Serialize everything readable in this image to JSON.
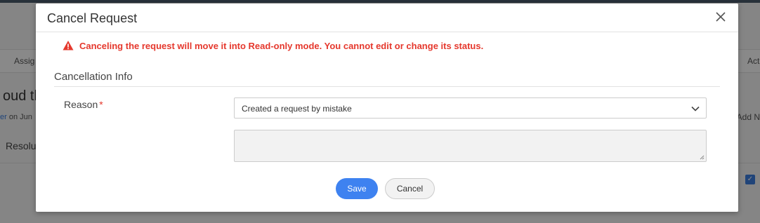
{
  "background": {
    "toolbar_left": "Assig",
    "toolbar_right": "Act",
    "title_fragment": "oud th",
    "meta_link": "er",
    "meta_text": "on Jun",
    "add_note": "Add N",
    "resolution_fragment": "Resolu"
  },
  "modal": {
    "title": "Cancel Request",
    "close_icon": "close-icon",
    "warning": {
      "icon": "warning-triangle-icon",
      "text": "Canceling the request will move it into Read-only mode. You cannot edit or change its status."
    },
    "section_title": "Cancellation Info",
    "reason": {
      "label": "Reason",
      "required_mark": "*",
      "selected_value": "Created a request by mistake",
      "details_value": ""
    },
    "buttons": {
      "save": "Save",
      "cancel": "Cancel"
    }
  },
  "colors": {
    "accent": "#3e82f0",
    "warning": "#e5382d"
  }
}
